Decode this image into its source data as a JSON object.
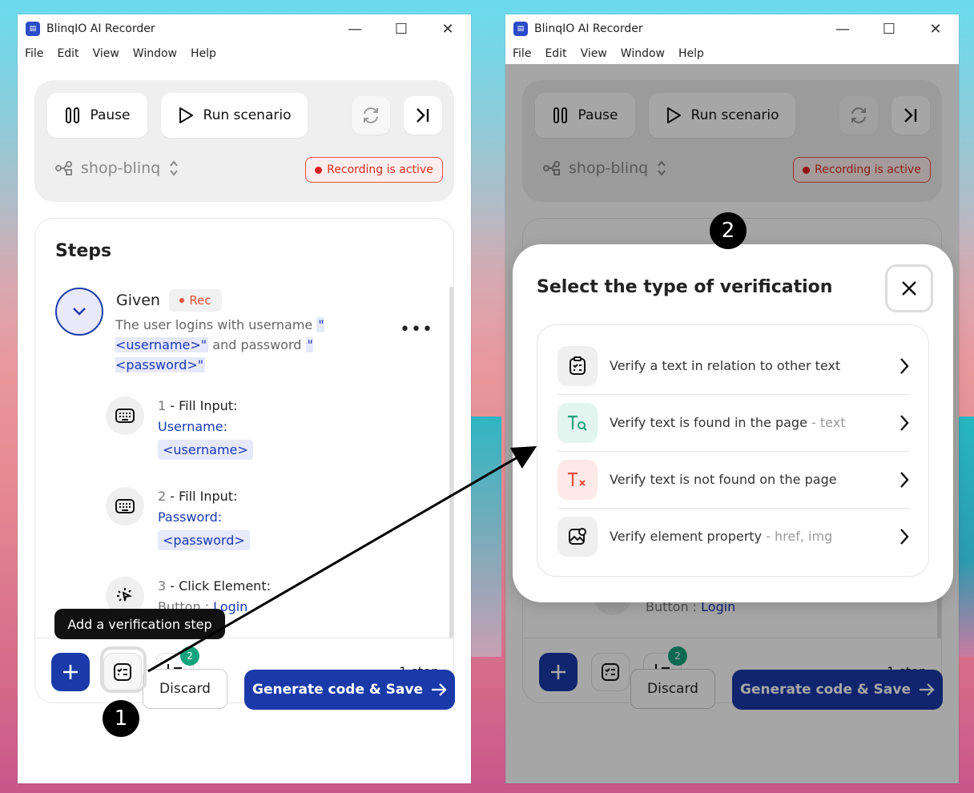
{
  "window": {
    "title": "BlinqIO AI Recorder",
    "controls": {
      "minimize": "—",
      "maximize": "☐",
      "close": "✕"
    }
  },
  "menu": [
    "File",
    "Edit",
    "View",
    "Window",
    "Help"
  ],
  "toolbar": {
    "pause": "Pause",
    "run": "Run scenario",
    "project": "shop-blinq",
    "recording": "Recording is active"
  },
  "steps": {
    "title": "Steps",
    "given": {
      "keyword": "Given",
      "rec": "Rec",
      "text_before": "The user logins with username ",
      "param1": "\"<username>\"",
      "text_mid": " and password ",
      "param2": "\"<password>\""
    },
    "items": [
      {
        "num": "1",
        "action": " - Fill Input:",
        "field": "Username:",
        "value": "<username>"
      },
      {
        "num": "2",
        "action": " - Fill Input:",
        "field": "Password:",
        "value": "<password>"
      },
      {
        "num": "3",
        "action": " - Click Element:",
        "field_prefix": "Button : ",
        "field": "Login"
      }
    ],
    "badge": "2",
    "count": "1 step"
  },
  "buttons": {
    "discard": "Discard",
    "generate": "Generate code & Save"
  },
  "tooltip": "Add a verification step",
  "callouts": [
    "1",
    "2"
  ],
  "modal": {
    "title": "Select the type of verification",
    "options": [
      {
        "label": "Verify a text in relation to other text",
        "hint": "",
        "icon": "clipboard-check-icon"
      },
      {
        "label": "Verify text is found in the page",
        "hint": " - text",
        "icon": "text-search-icon"
      },
      {
        "label": "Verify text is not found on the page",
        "hint": "",
        "icon": "text-remove-icon"
      },
      {
        "label": "Verify element property",
        "hint": " - href, img",
        "icon": "image-settings-icon"
      }
    ]
  },
  "colors": {
    "primary": "#1b3aa9",
    "recording": "#d93025",
    "badge": "#15a37d"
  }
}
